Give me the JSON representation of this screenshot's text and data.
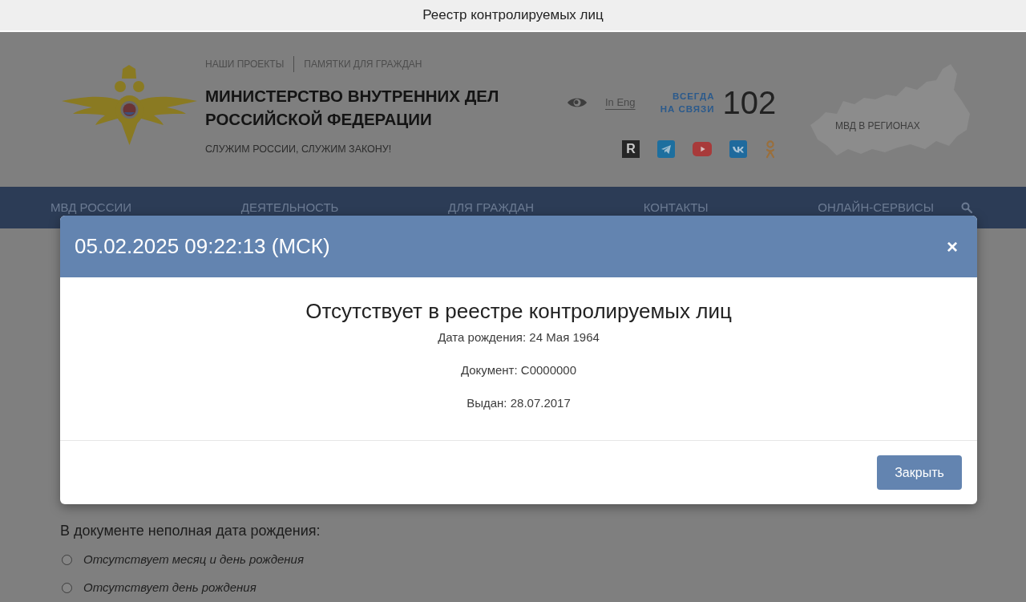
{
  "window": {
    "title": "Реестр контролируемых лиц"
  },
  "header": {
    "top_links": [
      "НАШИ ПРОЕКТЫ",
      "ПАМЯТКИ ДЛЯ ГРАЖДАН"
    ],
    "title": "МИНИСТЕРСТВО ВНУТРЕННИХ ДЕЛ РОССИЙСКОЙ ФЕДЕРАЦИИ",
    "tagline": "СЛУЖИМ РОССИИ, СЛУЖИМ ЗАКОНУ!",
    "language_link": "In Eng",
    "hotline": {
      "label": "ВСЕГДА НА СВЯЗИ",
      "number": "102"
    },
    "social": [
      {
        "kind": "letter",
        "glyph": "R",
        "color": "#262626"
      },
      {
        "kind": "plane",
        "color": "#1d6f9f"
      },
      {
        "kind": "play",
        "color": "#a83a3a"
      },
      {
        "kind": "vk",
        "color": "#1f6a9d"
      },
      {
        "kind": "figure",
        "color": "#9a6f3c"
      }
    ],
    "regions_link": "МВД В РЕГИОНАХ"
  },
  "nav": {
    "items": [
      "МВД РОССИИ",
      "ДЕЯТЕЛЬНОСТЬ",
      "ДЛЯ ГРАЖДАН",
      "КОНТАКТЫ",
      "ОНЛАЙН-СЕРВИСЫ"
    ]
  },
  "modal": {
    "title": "05.02.2025 09:22:13 (МСК)",
    "close": "×",
    "heading": "Отсутствует в реестре контролируемых лиц",
    "details": [
      "Дата рождения: 24 Мая 1964",
      "Документ: С0000000",
      "Выдан: 28.07.2017"
    ],
    "button": "Закрыть"
  },
  "form": {
    "question": "В документе неполная дата рождения:",
    "options": [
      {
        "label": "Отсутствует месяц и день рождения",
        "selected": false
      },
      {
        "label": "Отсутствует день рождения",
        "selected": false
      }
    ]
  }
}
